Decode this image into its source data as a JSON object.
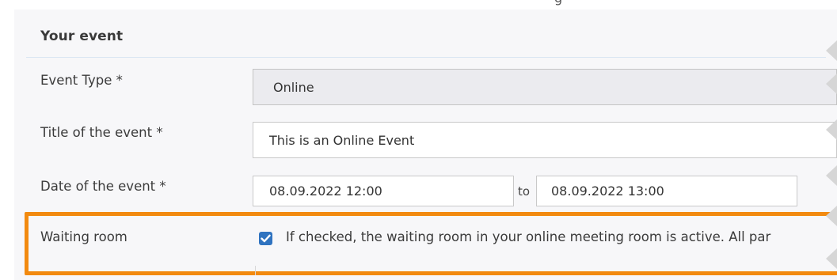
{
  "top": {
    "cropped_text": "g"
  },
  "section": {
    "title": "Your event"
  },
  "fields": {
    "event_type": {
      "label": "Event Type *",
      "value": "Online"
    },
    "title": {
      "label": "Title of the event *",
      "value": "This is an Online Event"
    },
    "date": {
      "label": "Date of the event *",
      "start": "08.09.2022 12:00",
      "separator": "to",
      "end": "08.09.2022 13:00"
    },
    "waiting_room": {
      "label": "Waiting room",
      "checked": true,
      "description": "If checked, the waiting room in your online meeting room is active. All par"
    }
  },
  "icons": {
    "checkbox": "checkmark-icon",
    "edge_markers": "chevron-left-icon"
  },
  "colors": {
    "highlight": "#f28a10",
    "checkbox": "#2f73c0",
    "disabled_field": "#ebebef"
  }
}
